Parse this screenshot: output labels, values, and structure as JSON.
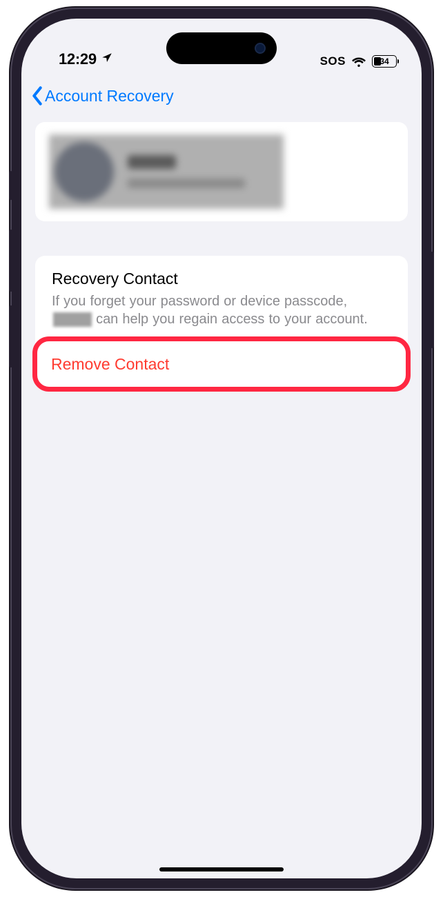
{
  "status": {
    "time": "12:29",
    "sos": "SOS",
    "battery_percent": "34"
  },
  "nav": {
    "back_label": "Account Recovery"
  },
  "section": {
    "title": "Recovery Contact",
    "desc_part1": "If you forget your password or device passcode,",
    "desc_part2": "can help you regain access to your account."
  },
  "action": {
    "remove_label": "Remove Contact"
  }
}
